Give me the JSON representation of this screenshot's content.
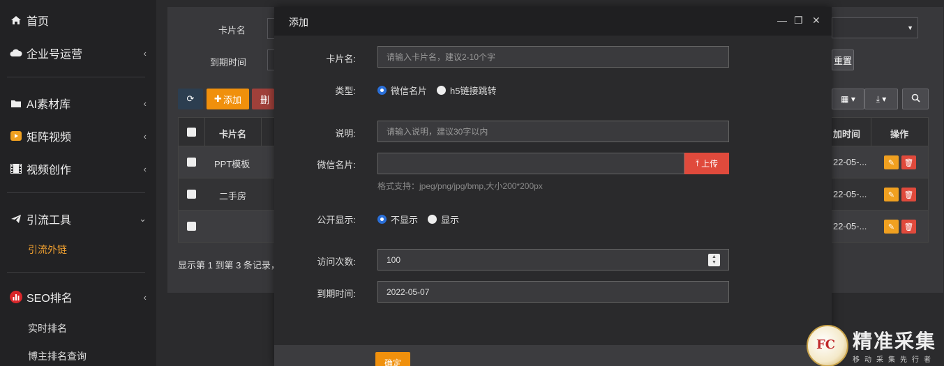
{
  "sidebar": {
    "items": [
      {
        "label": "首页",
        "icon": "home-icon"
      },
      {
        "label": "企业号运营",
        "icon": "cloud-icon"
      },
      {
        "label": "AI素材库",
        "icon": "folder-icon"
      },
      {
        "label": "矩阵视频",
        "icon": "youtube-play-icon"
      },
      {
        "label": "视频创作",
        "icon": "film-icon"
      },
      {
        "label": "引流工具",
        "icon": "paper-plane-icon"
      },
      {
        "label": "SEO排名",
        "icon": "bar-chart-icon"
      }
    ],
    "sub_items": [
      "引流外链",
      "实时排名",
      "博主排名查询"
    ]
  },
  "background": {
    "filter_labels": [
      "卡片名",
      "到期时间"
    ],
    "toolbar": {
      "refresh_icon": "refresh-icon",
      "add_label": "添加",
      "delete_label": "删",
      "reset_label": "重置"
    },
    "table": {
      "headers": [
        "卡片名",
        "加时间",
        "操作"
      ],
      "rows": [
        {
          "name": "PPT模板",
          "date": "22-05-..."
        },
        {
          "name": "二手房",
          "date": "22-05-..."
        },
        {
          "name": "",
          "date": "22-05-..."
        }
      ]
    },
    "pagination_text": "显示第 1 到第 3 条记录，"
  },
  "modal": {
    "title": "添加",
    "fields": {
      "card_name": {
        "label": "卡片名:",
        "placeholder": "请输入卡片名，建议2-10个字"
      },
      "type": {
        "label": "类型:",
        "options": [
          "微信名片",
          "h5链接跳转"
        ],
        "selected": "微信名片"
      },
      "desc": {
        "label": "说明:",
        "placeholder": "请输入说明，建议30字以内"
      },
      "wechat_card": {
        "label": "微信名片:",
        "upload_label": "上传",
        "hint": "格式支持：jpeg/png/jpg/bmp,大小200*200px"
      },
      "public": {
        "label": "公开显示:",
        "options": [
          "不显示",
          "显示"
        ],
        "selected": "不显示"
      },
      "visits": {
        "label": "访问次数:",
        "value": "100"
      },
      "expire": {
        "label": "到期时间:",
        "value": "2022-05-07"
      }
    },
    "confirm_label": "确定"
  },
  "watermark": {
    "text": "精准采集",
    "sub": "移动采集先行者",
    "logo_text": "FC"
  },
  "colors": {
    "accent": "#f0900c",
    "danger": "#e04a3c",
    "radio": "#2a6fd8",
    "active_menu": "#f0a030"
  }
}
